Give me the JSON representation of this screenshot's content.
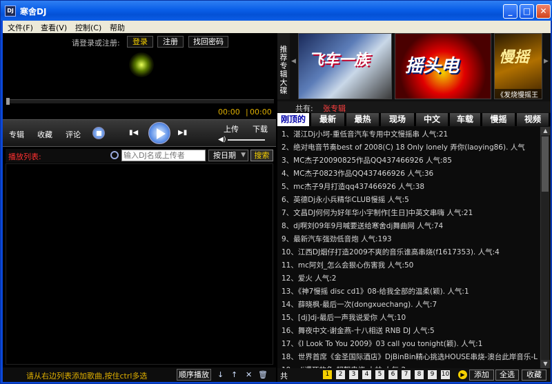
{
  "window": {
    "title": "寒舍DJ",
    "app_icon_text": "DJ",
    "minimize": "_",
    "maximize": "□",
    "close": "✕"
  },
  "menu": [
    "文件(F)",
    "查看(V)",
    "控制(C)",
    "帮助"
  ],
  "login": {
    "prompt": "请登录或注册:",
    "login_label": "登录",
    "register_label": "注册",
    "recover_label": "找回密码"
  },
  "player": {
    "time_current": "00:00",
    "time_separator": "|",
    "time_total": "00:00",
    "album_label": "专辑",
    "favorite_label": "收藏",
    "comment_label": "评论",
    "prev_icon": "▮◀",
    "next_icon": "▶▮",
    "upload_label": "上传",
    "download_label": "下载",
    "volume_icon": "◀)"
  },
  "playlist": {
    "label": "播放列表:",
    "search_placeholder": "输入DJ名或上传者",
    "sort_label": "按日期",
    "sort_arrow": "▼",
    "search_button": "搜索"
  },
  "left_footer": {
    "hint": "请从右边列表添加歌曲,按住ctrl多选",
    "order_label": "顺序播放",
    "down_icon": "↓",
    "up_icon": "↑",
    "delete_icon": "✕",
    "trash_icon": "🗑"
  },
  "albums": {
    "side_label": "推荐专辑大碟",
    "left_arrow": "◀",
    "right_arrow": "▶",
    "items": [
      {
        "title": "飞车一族",
        "caption": ""
      },
      {
        "title": "摇头电",
        "caption": ""
      },
      {
        "title": "慢摇",
        "caption": "《发烧慢摇王"
      }
    ]
  },
  "count": {
    "label": "共有:",
    "value": "张专辑"
  },
  "tabs": [
    {
      "label": "刚顶的",
      "active": true
    },
    {
      "label": "最新",
      "active": false
    },
    {
      "label": "最热",
      "active": false
    },
    {
      "label": "现场",
      "active": false
    },
    {
      "label": "中文",
      "active": false
    },
    {
      "label": "车载",
      "active": false
    },
    {
      "label": "慢摇",
      "active": false
    },
    {
      "label": "视频",
      "active": false
    }
  ],
  "list_items": [
    "1、湛江Dj小坷-重低音汽车专用中文慢摇串 人气:21",
    "2、绝对电音节奏best of 2008(C) 18 Only lonely 弄你(laoying86). 人气",
    "3、MC杰子20090825作品QQ437466926 人气:85",
    "4、MC杰子0823作品QQ437466926 人气:36",
    "5、mc杰子9月打造qq437466926 人气:38",
    "6、英德Dj永小兵精华CLUB慢摇 人气:5",
    "7、文昌DJ何何为好年华小宇制作[生日]中英文串嗨 人气:21",
    "8、dj啊刘09年9月喊要送给寒舍dj舞曲网 人气:74",
    "9、最新汽车强劲低音炮 人气:193",
    "10、江西DJ烟仔打造2009不爽的音乐谁高串烧(f1617353). 人气:4",
    "11、mc阿刘_怎么会狠心伤害我 人气:50",
    "12、爱火 人气:2",
    "13、《神7慢摇 disc cd1》08-给我全部的温柔(颖). 人气:1",
    "14、薛晓枫-最后一次(dongxuechang). 人气:7",
    "15、[dj]dj-最后一声我说爱你 人气:10",
    "16、舞夜中文-谢金燕-十八相送 RNB DJ 人气:5",
    "17、《I Look To You 2009》03 call you tonight(颖). 人气:1",
    "18、世界首席《金圣国际酒店》DjBinBin精心挑选HOUSE串烧-澳台此岸音乐-L",
    "19、dj遇死的鱼-超靓串烧 小林 人气:2"
  ],
  "right_footer": {
    "total_label": "共",
    "pages": [
      "1",
      "2",
      "3",
      "4",
      "5",
      "6",
      "7",
      "8",
      "9",
      "10"
    ],
    "current_page": "1",
    "next_icon": "▶",
    "add_label": "添加",
    "select_all_label": "全选",
    "favorite_label": "收藏"
  },
  "colors": {
    "accent_yellow": "#f6d000",
    "playlist_red": "#ff3030",
    "titlebar_blue": "#0a5fe8"
  }
}
